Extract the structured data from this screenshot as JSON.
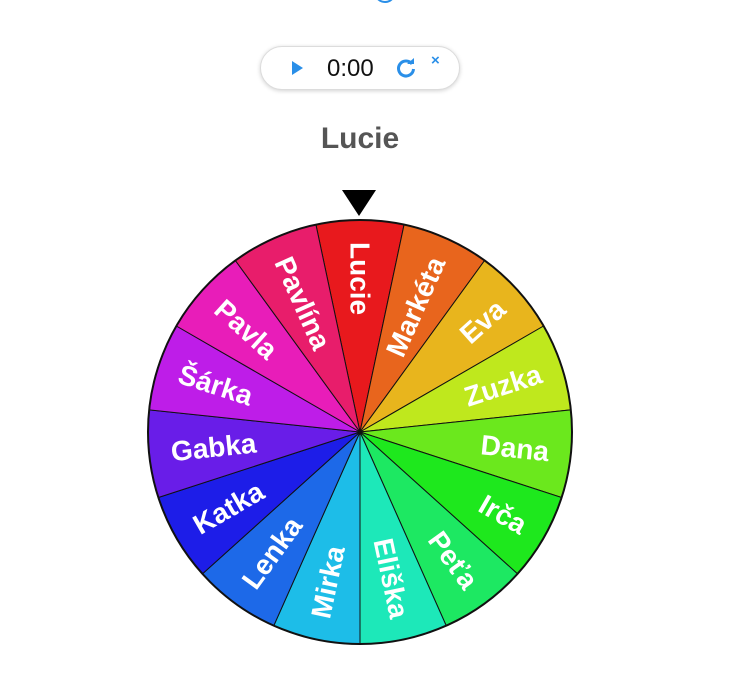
{
  "timer": {
    "time": "0:00",
    "play_icon": "play-icon",
    "reset_icon": "reset-icon",
    "close_label": "×"
  },
  "result": {
    "winner": "Lucie"
  },
  "wheel": {
    "segments": [
      {
        "label": "Lucie",
        "color": "#e8191d"
      },
      {
        "label": "Markéta",
        "color": "#e8651d"
      },
      {
        "label": "Eva",
        "color": "#e8b51d"
      },
      {
        "label": "Zuzka",
        "color": "#bfe81d"
      },
      {
        "label": "Dana",
        "color": "#6be81d"
      },
      {
        "label": "Irča",
        "color": "#1ee81d"
      },
      {
        "label": "Peťa",
        "color": "#1de862"
      },
      {
        "label": "Eliška",
        "color": "#1de8b9"
      },
      {
        "label": "Mirka",
        "color": "#1dbde8"
      },
      {
        "label": "Lenka",
        "color": "#1d69e8"
      },
      {
        "label": "Katka",
        "color": "#1d1de8"
      },
      {
        "label": "Gabka",
        "color": "#691de8"
      },
      {
        "label": "Šárka",
        "color": "#be1de8"
      },
      {
        "label": "Pavla",
        "color": "#e81db9"
      },
      {
        "label": "Pavlína",
        "color": "#e81d6b"
      }
    ]
  }
}
